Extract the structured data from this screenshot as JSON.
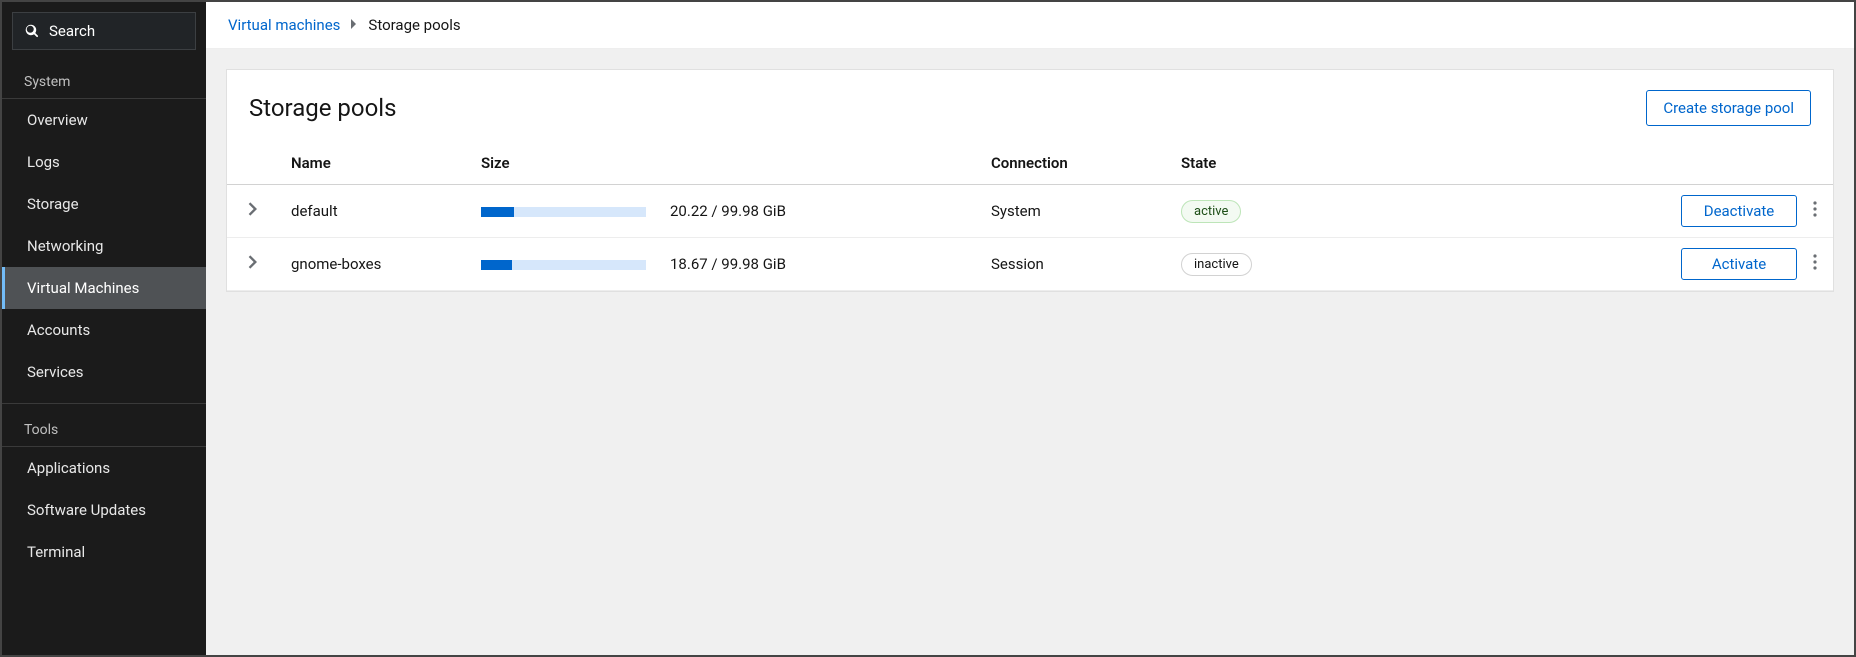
{
  "sidebar": {
    "search_label": "Search",
    "sections": [
      {
        "label": "System",
        "items": [
          {
            "label": "Overview",
            "active": false
          },
          {
            "label": "Logs",
            "active": false
          },
          {
            "label": "Storage",
            "active": false
          },
          {
            "label": "Networking",
            "active": false
          },
          {
            "label": "Virtual Machines",
            "active": true
          },
          {
            "label": "Accounts",
            "active": false
          },
          {
            "label": "Services",
            "active": false
          }
        ]
      },
      {
        "label": "Tools",
        "items": [
          {
            "label": "Applications",
            "active": false
          },
          {
            "label": "Software Updates",
            "active": false
          },
          {
            "label": "Terminal",
            "active": false
          }
        ]
      }
    ]
  },
  "breadcrumb": {
    "parent": "Virtual machines",
    "current": "Storage pools"
  },
  "page": {
    "title": "Storage pools",
    "create_button": "Create storage pool"
  },
  "table": {
    "headers": {
      "name": "Name",
      "size": "Size",
      "connection": "Connection",
      "state": "State"
    },
    "rows": [
      {
        "name": "default",
        "used": 20.22,
        "total": 99.98,
        "size_text": "20.22 / 99.98 GiB",
        "percent": 20.2,
        "connection": "System",
        "state": "active",
        "state_label": "active",
        "action_label": "Deactivate"
      },
      {
        "name": "gnome-boxes",
        "used": 18.67,
        "total": 99.98,
        "size_text": "18.67 / 99.98 GiB",
        "percent": 18.7,
        "connection": "Session",
        "state": "inactive",
        "state_label": "inactive",
        "action_label": "Activate"
      }
    ]
  }
}
